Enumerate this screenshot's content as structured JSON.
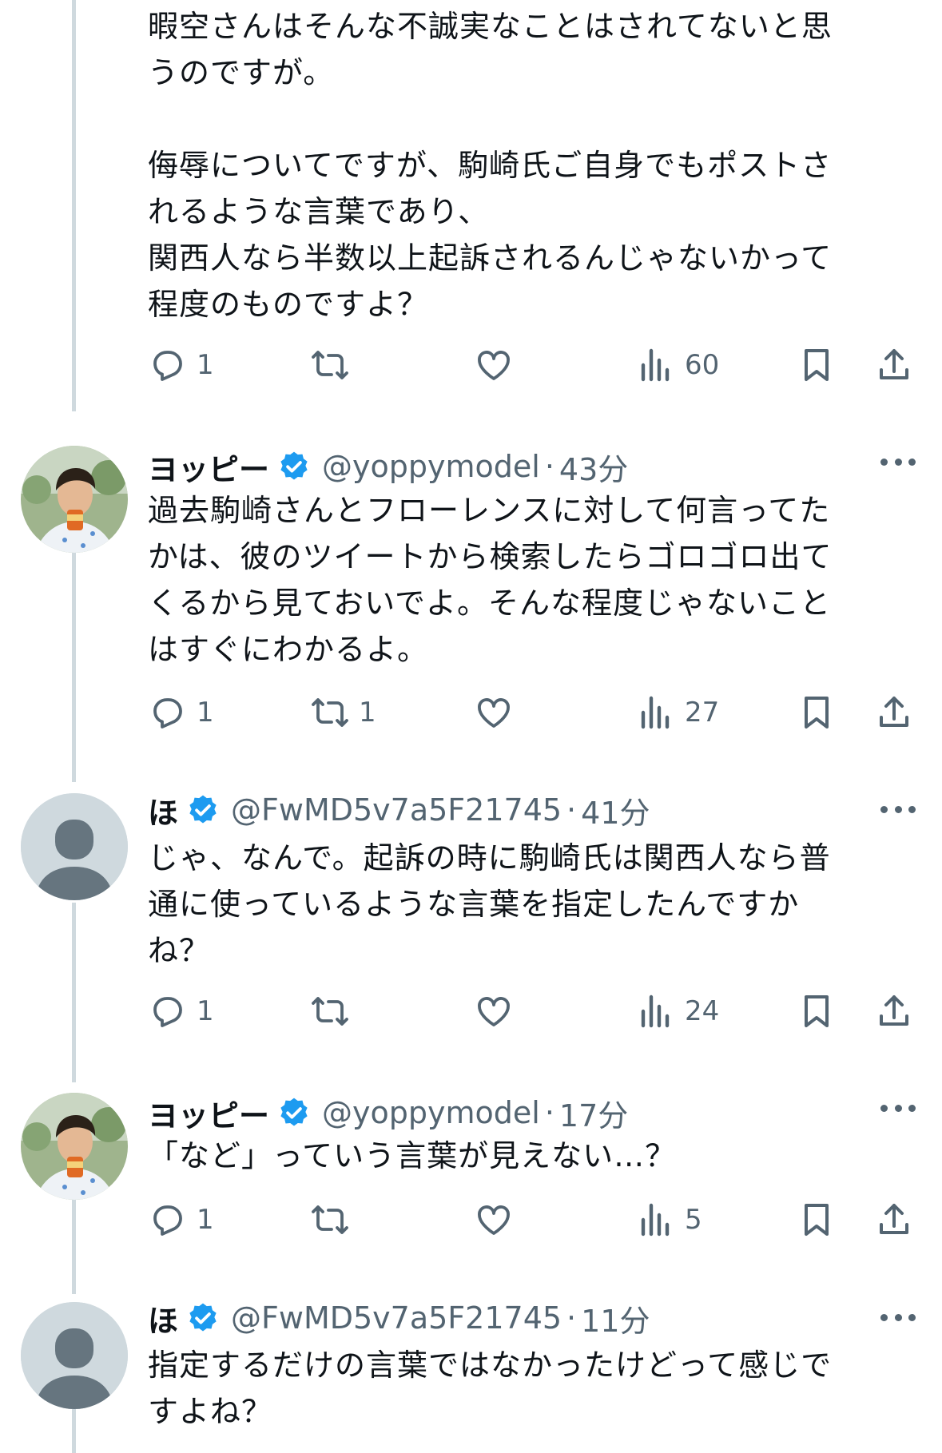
{
  "posts": [
    {
      "text": "暇空さんはそんな不誠実なことはされてないと思\nうのですが。\n\n侮辱についてですが、駒崎氏ご自身でもポストさ\nれるような言葉であり、\n関西人なら半数以上起訴されるんじゃないかって\n程度のものですよ？",
      "actions": {
        "reply": "1",
        "retweet": "",
        "like": "",
        "views": "60"
      }
    },
    {
      "name": "ヨッピー",
      "handle": "@yoppymodel",
      "dot": "·",
      "time": "43分",
      "avatar": "photo-avatar",
      "text": "過去駒崎さんとフローレンスに対して何言ってた\nかは、彼のツイートから検索したらゴロゴロ出て\nくるから見ておいでよ。そんな程度じゃないこと\nはすぐにわかるよ。",
      "actions": {
        "reply": "1",
        "retweet": "1",
        "like": "",
        "views": "27"
      }
    },
    {
      "name": "ほ",
      "handle": "@FwMD5v7a5F21745",
      "dot": "·",
      "time": "41分",
      "avatar": "default-avatar",
      "text": "じゃ、なんで。起訴の時に駒崎氏は関西人なら普\n通に使っているような言葉を指定したんですか\nね？",
      "actions": {
        "reply": "1",
        "retweet": "",
        "like": "",
        "views": "24"
      }
    },
    {
      "name": "ヨッピー",
      "handle": "@yoppymodel",
      "dot": "·",
      "time": "17分",
      "avatar": "photo-avatar",
      "text": "「など」っていう言葉が見えない…？",
      "actions": {
        "reply": "1",
        "retweet": "",
        "like": "",
        "views": "5"
      }
    },
    {
      "name": "ほ",
      "handle": "@FwMD5v7a5F21745",
      "dot": "·",
      "time": "11分",
      "avatar": "default-avatar",
      "text": "指定するだけの言葉ではなかったけどって感じで\nすよね？"
    }
  ],
  "colors": {
    "text": "#0f1419",
    "muted": "#536471",
    "verified": "#1d9bf0",
    "thread": "#cfd9de"
  },
  "icons": [
    "reply-icon",
    "retweet-icon",
    "like-icon",
    "views-icon",
    "bookmark-icon",
    "share-icon",
    "verified-badge-icon",
    "more-icon"
  ]
}
